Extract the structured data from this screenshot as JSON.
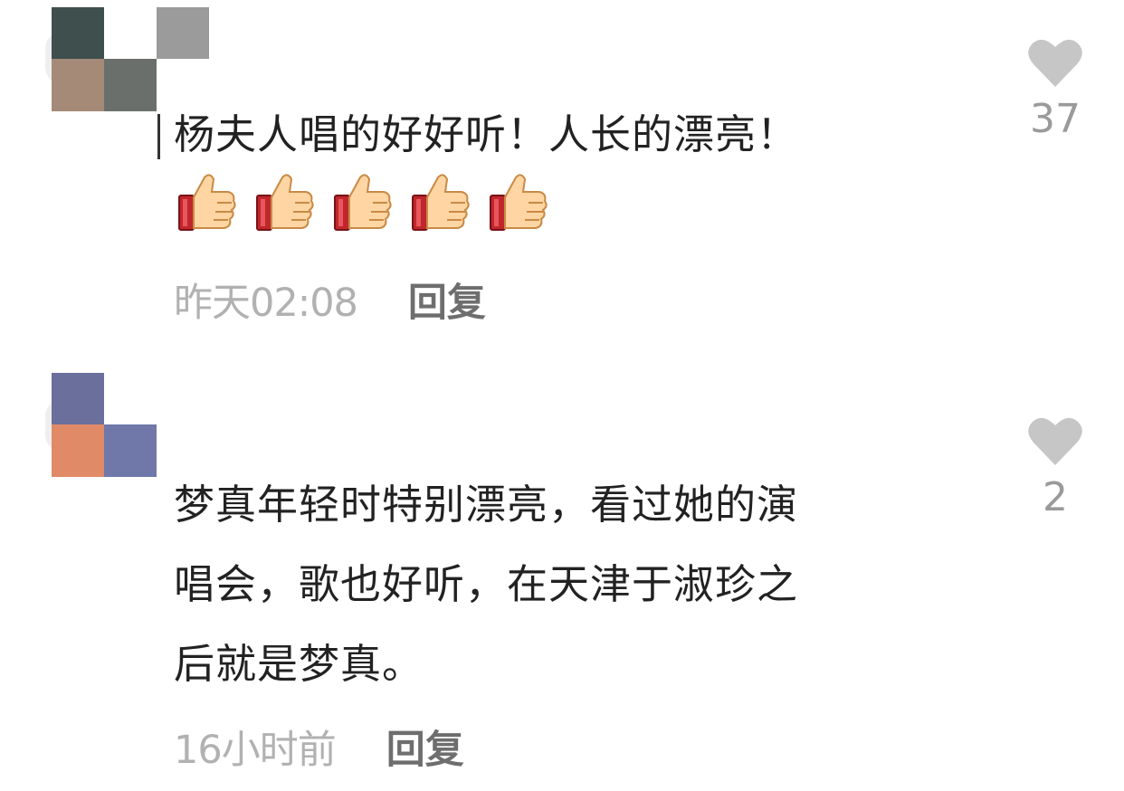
{
  "comments": [
    {
      "text": "杨夫人唱的好好听！人长的漂亮！",
      "emoji": [
        "thumbs-up",
        "thumbs-up",
        "thumbs-up",
        "thumbs-up",
        "thumbs-up"
      ],
      "time": "昨天02:08",
      "reply_label": "回复",
      "like_count": "37",
      "avatar_colors": [
        "#3f4f4d",
        "#ffffff",
        "#9b9b9b",
        "#a58a78",
        "#6b6f6c",
        "#ffffff"
      ]
    },
    {
      "text": "梦真年轻时特别漂亮，看过她的演\n唱会，歌也好听，在天津于淑珍之\n后就是梦真。",
      "emoji": [],
      "time": "16小时前",
      "reply_label": "回复",
      "like_count": "2",
      "avatar_colors": [
        "#6a6f9c",
        "#ffffff",
        "#ffffff",
        "#e08a68",
        "#6f78a9",
        "#ffffff"
      ]
    }
  ],
  "colors": {
    "text": "#222222",
    "time": "#b1b1b1",
    "reply": "#6e6e6e",
    "heart": "#c6c6c6",
    "count": "#9a9a9a"
  }
}
